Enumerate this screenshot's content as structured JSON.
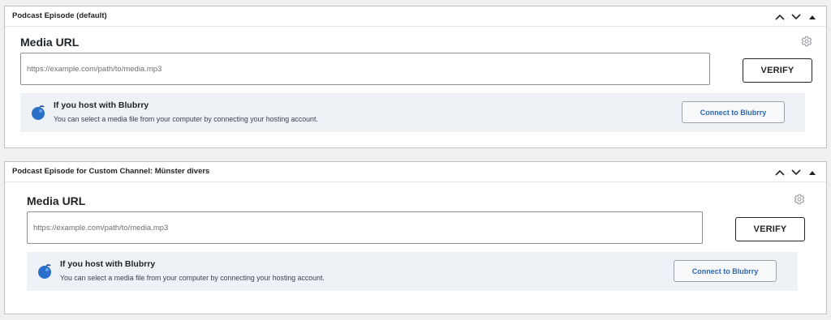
{
  "metaboxes": [
    {
      "title": "Podcast Episode (default)",
      "media_url_label": "Media URL",
      "url_placeholder": "https://example.com/path/to/media.mp3",
      "verify_label": "VERIFY",
      "blubrry_heading": "If you host with Blubrry",
      "blubrry_desc": "You can select a media file from your computer by connecting your hosting account.",
      "connect_label": "Connect to Blubrry"
    },
    {
      "title": "Podcast Episode for Custom Channel: Münster divers",
      "media_url_label": "Media URL",
      "url_placeholder": "https://example.com/path/to/media.mp3",
      "verify_label": "VERIFY",
      "blubrry_heading": "If you host with Blubrry",
      "blubrry_desc": "You can select a media file from your computer by connecting your hosting account.",
      "connect_label": "Connect to Blubrry"
    }
  ],
  "icons": {
    "move_up": "chevron-up-icon",
    "move_down": "chevron-down-icon",
    "toggle": "triangle-up-icon",
    "settings": "gear-icon",
    "brand": "blubrry-logo-icon"
  },
  "colors": {
    "page_bg": "#f0f0f1",
    "panel_bg": "#eef1f6",
    "link_blue": "#2a66b4",
    "logo_blue": "#2a6fc9"
  }
}
